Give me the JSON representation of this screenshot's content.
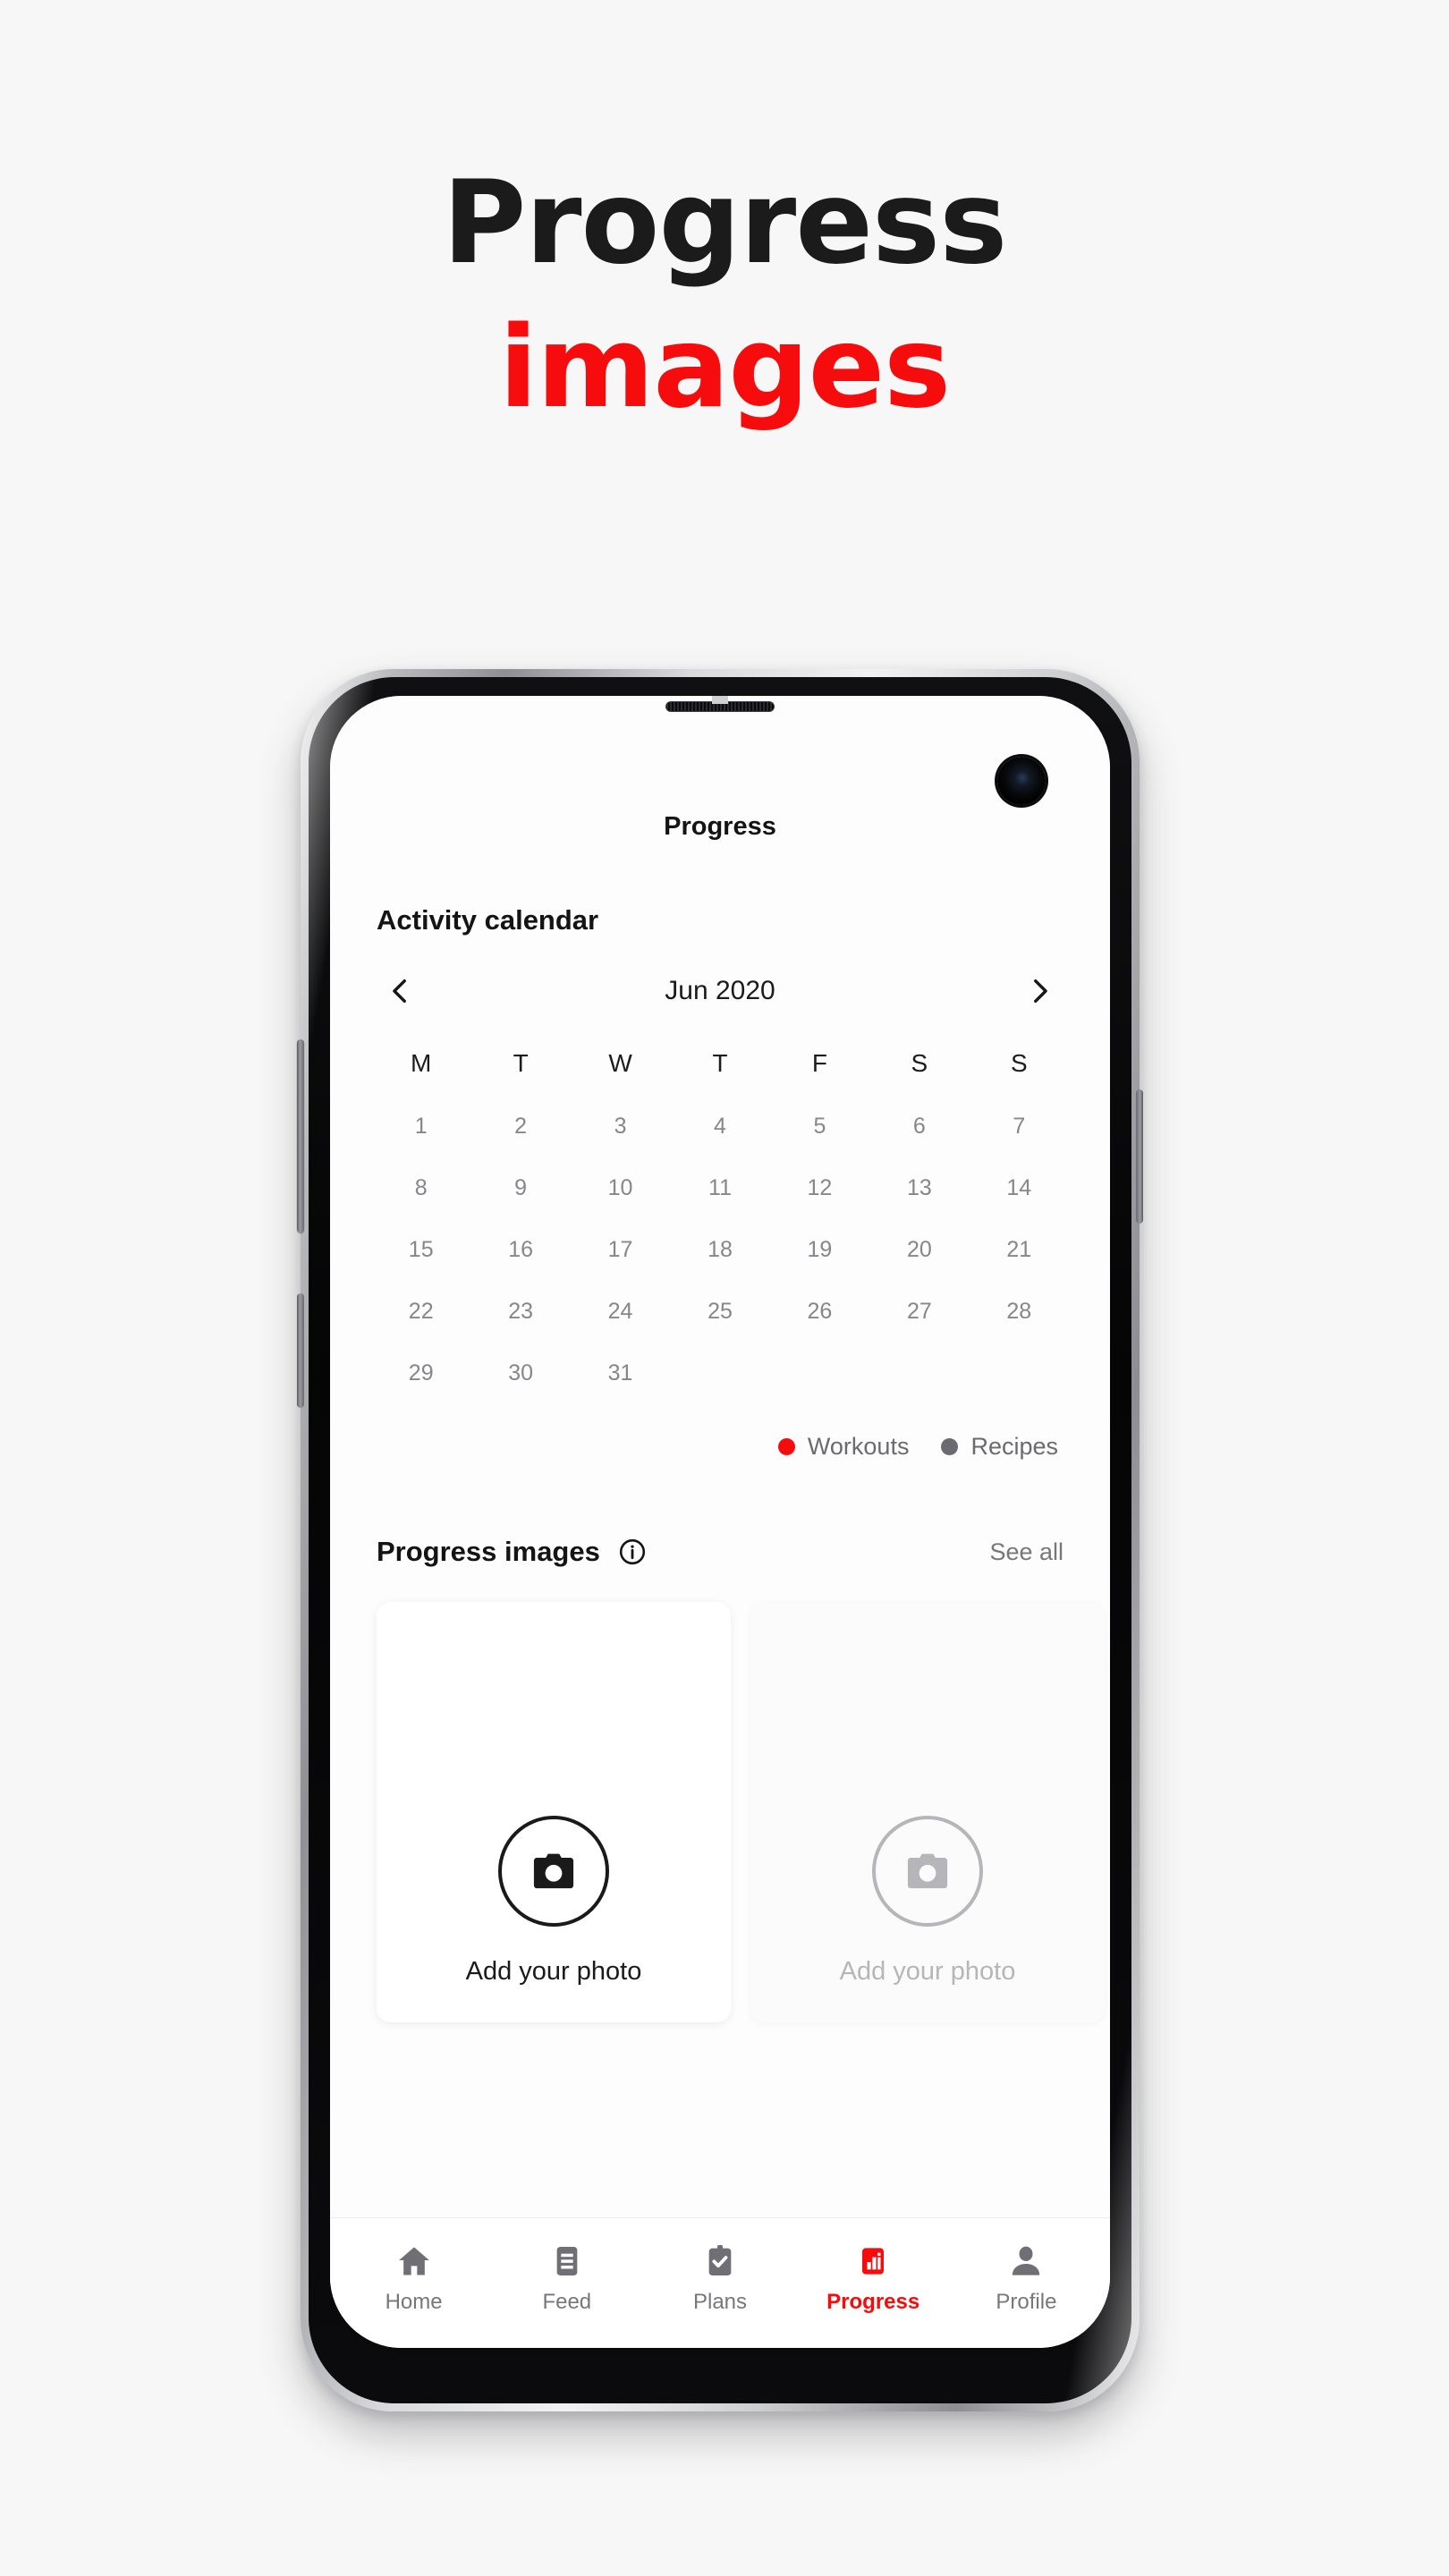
{
  "poster": {
    "line1": "Progress",
    "line2": "images",
    "accent_color": "#f60c0c",
    "dark_color": "#1b1b1b",
    "background_color": "#f7f7f7"
  },
  "device": {
    "name": "smartphone-mockup",
    "camera_icon": "front-camera-punch-hole",
    "earpiece_icon": "earpiece-speaker"
  },
  "app": {
    "title": "Progress",
    "activity_calendar": {
      "section_title": "Activity calendar",
      "prev_icon": "chevron-left-icon",
      "next_icon": "chevron-right-icon",
      "month_label": "Jun 2020",
      "weekday_headers": [
        "M",
        "T",
        "W",
        "T",
        "F",
        "S",
        "S"
      ],
      "days": [
        "1",
        "2",
        "3",
        "4",
        "5",
        "6",
        "7",
        "8",
        "9",
        "10",
        "11",
        "12",
        "13",
        "14",
        "15",
        "16",
        "17",
        "18",
        "19",
        "20",
        "21",
        "22",
        "23",
        "24",
        "25",
        "26",
        "27",
        "28",
        "29",
        "30",
        "31"
      ],
      "legend": [
        {
          "label": "Workouts",
          "color": "#f60c0c",
          "icon": "legend-dot-workouts"
        },
        {
          "label": "Recipes",
          "color": "#6a6a70",
          "icon": "legend-dot-recipes"
        }
      ]
    },
    "progress_images": {
      "section_title": "Progress images",
      "info_icon": "info-circle-icon",
      "see_all_label": "See all",
      "cards": [
        {
          "label": "Add your photo",
          "icon": "camera-icon",
          "state": "active"
        },
        {
          "label": "Add your photo",
          "icon": "camera-icon",
          "state": "disabled"
        }
      ]
    },
    "bottom_nav": {
      "items": [
        {
          "label": "Home",
          "icon": "home-icon",
          "active": false
        },
        {
          "label": "Feed",
          "icon": "feed-icon",
          "active": false
        },
        {
          "label": "Plans",
          "icon": "clipboard-check-icon",
          "active": false
        },
        {
          "label": "Progress",
          "icon": "bar-chart-icon",
          "active": true
        },
        {
          "label": "Profile",
          "icon": "person-icon",
          "active": false
        }
      ],
      "active_color": "#f60c0c",
      "inactive_color": "#77777d"
    }
  }
}
